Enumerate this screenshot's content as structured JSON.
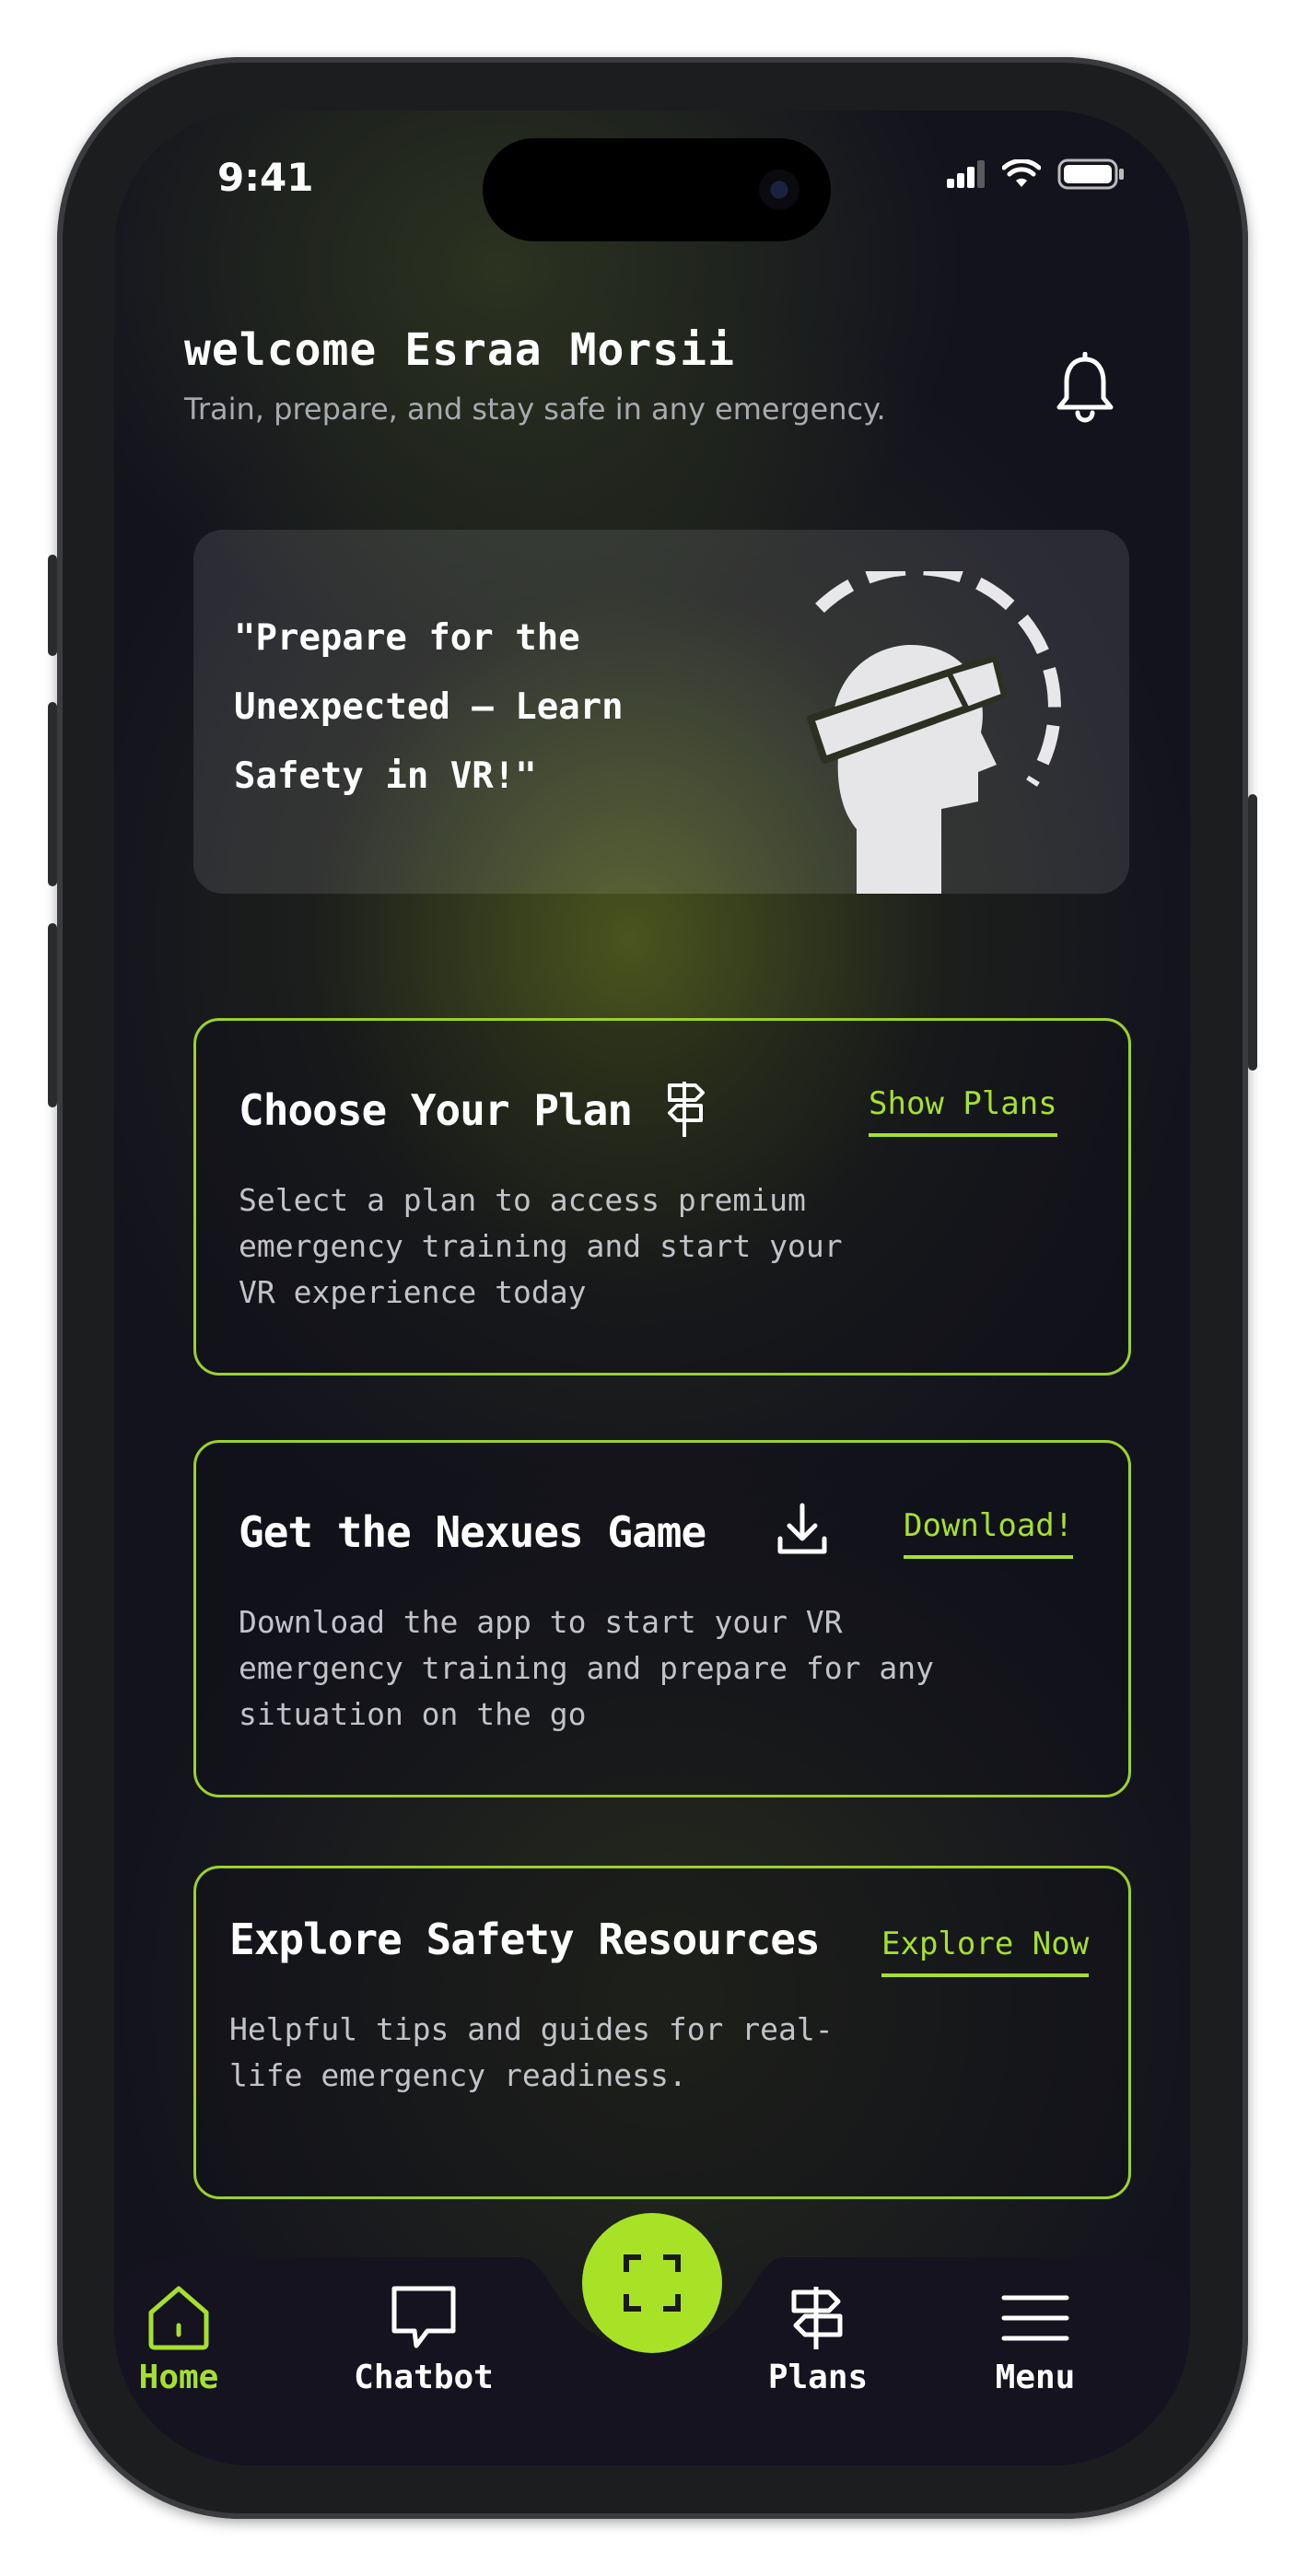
{
  "status_bar": {
    "time": "9:41"
  },
  "header": {
    "welcome": "welcome Esraa Morsii",
    "subtitle": "Train, prepare, and stay safe in any emergency."
  },
  "hero": {
    "quote": "\"Prepare for the Unexpected – Learn Safety in VR!\""
  },
  "cards": [
    {
      "title": "Choose Your Plan",
      "description": "Select a plan to access premium emergency training and start your VR experience today",
      "link": "Show Plans",
      "icon": "signpost-icon"
    },
    {
      "title": "Get the Nexues Game",
      "description": "Download the app to start your VR emergency training and prepare for any situation on the go",
      "link": "Download!",
      "icon": "download-icon"
    },
    {
      "title": "Explore Safety Resources",
      "description": "Helpful tips and guides for real-life emergency readiness.",
      "link": "Explore Now"
    }
  ],
  "nav": {
    "items": [
      {
        "label": "Home",
        "icon": "home-icon",
        "active": true
      },
      {
        "label": "Chatbot",
        "icon": "chat-bubble-icon",
        "active": false
      },
      {
        "label": "Plans",
        "icon": "signpost-icon",
        "active": false
      },
      {
        "label": "Menu",
        "icon": "hamburger-menu-icon",
        "active": false
      }
    ],
    "center_action_icon": "scan-icon"
  },
  "colors": {
    "accent": "#a6e02e",
    "background": "#13131d",
    "text": "#ffffff",
    "muted_text": "#a9aab0"
  }
}
